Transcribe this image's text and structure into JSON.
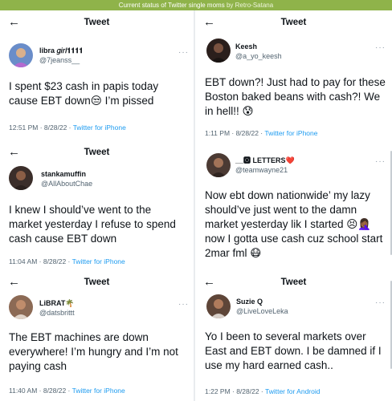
{
  "banner": {
    "caption": "Current status of Twitter single moms",
    "credit": "by Retro-Satana"
  },
  "panels": [
    {
      "header": "Tweet",
      "name": "libra 𝑔𝑖𝑟𝑙𝟏𝟏𝟏𝟏",
      "handle": "@7jeanss__",
      "text": "I spent $23 cash in papis today cause EBT down😒 I’m pissed",
      "time": "12:51 PM · 8/28/22 · ",
      "source": "Twitter for iPhone",
      "avatar_color": "#6a8dc9"
    },
    {
      "header": "Tweet",
      "name": "Keesh",
      "handle": "@a_yo_keesh",
      "text": "EBT down?! Just had to pay for these Boston baked beans with cash?! We in hell!! 😰",
      "time": "1:11 PM · 8/28/22 · ",
      "source": "Twitter for iPhone",
      "avatar_color": "#2b1f1c"
    },
    {
      "header": "Tweet",
      "name": "stankamuffin",
      "handle": "@AllAboutChae",
      "text": "I knew I should’ve went to the market yesterday I refuse to spend cash cause EBT down",
      "time": "11:04 AM · 8/28/22 · ",
      "source": "Twitter for iPhone",
      "avatar_color": "#3b2e2a"
    },
    {
      "header": "",
      "name": "__🅾 LETTERS❤️",
      "handle": "@teamwayne21",
      "text": "Now ebt down nationwide’ my lazy should’ve just went to the damn market yesterday lik I started 😣🤦🏾‍♀️ now I gotta use cash cuz school start 2mar fml 😷",
      "time": "",
      "source": "",
      "avatar_color": "#4b3a33"
    },
    {
      "header": "Tweet",
      "name": "LiBRAT🌴",
      "handle": "@datsbrittt",
      "text": "The EBT machines are down everywhere! I’m hungry and I’m not paying cash",
      "time": "11:40 AM · 8/28/22 · ",
      "source": "Twitter for iPhone",
      "avatar_color": "#8c6a55"
    },
    {
      "header": "Tweet",
      "name": "Suzie Q",
      "handle": "@LiveLoveLeka",
      "text": "Yo I been to several markets over East and EBT down. I be damned if I use my hard earned cash..",
      "time": "1:22 PM · 8/28/22 · ",
      "source": "Twitter for Android",
      "avatar_color": "#5e4538"
    }
  ],
  "icons": {
    "back": "back-arrow-icon",
    "more": "more-options-icon"
  }
}
